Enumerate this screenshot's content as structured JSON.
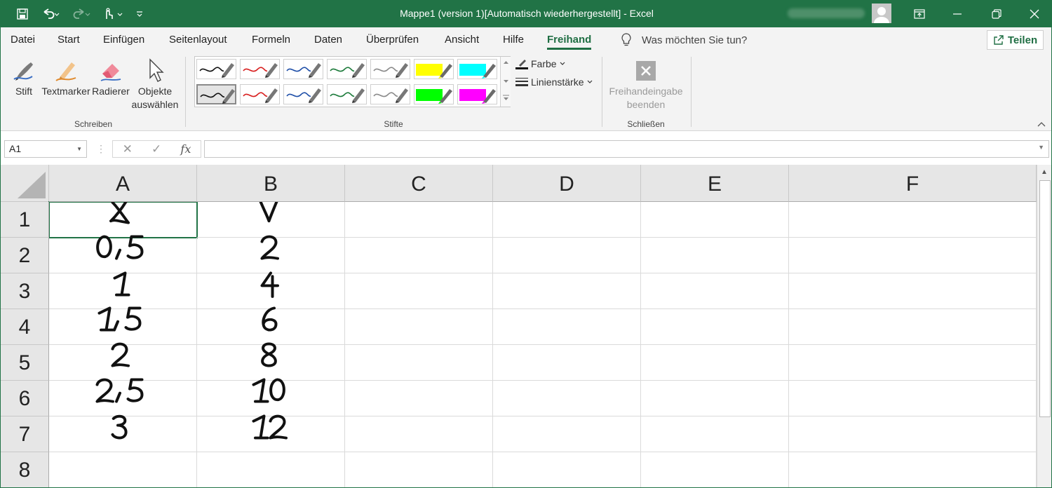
{
  "titlebar": {
    "title": "Mappe1 (version 1)[Automatisch wiederhergestellt]  -  Excel"
  },
  "tabs": [
    "Datei",
    "Start",
    "Einfügen",
    "Seitenlayout",
    "Formeln",
    "Daten",
    "Überprüfen",
    "Ansicht",
    "Hilfe",
    "Freihand"
  ],
  "active_tab": "Freihand",
  "tell_me": "Was möchten Sie tun?",
  "share": "Teilen",
  "ribbon": {
    "schreiben": {
      "label": "Schreiben",
      "stift": "Stift",
      "textmarker": "Textmarker",
      "radierer": "Radierer",
      "objekte_line1": "Objekte",
      "objekte_line2": "auswählen"
    },
    "stifte": {
      "label": "Stifte",
      "pen_colors_row1": [
        "#111111",
        "#d81e1e",
        "#1f4fa8",
        "#1b7a3a",
        "#8a8a8a",
        "#ffff00",
        "#00ffff"
      ],
      "pen_colors_row2": [
        "#111111",
        "#d81e1e",
        "#1f4fa8",
        "#1b7a3a",
        "#8a8a8a",
        "#00ff00",
        "#ff00ff"
      ],
      "farbe": "Farbe",
      "linienstaerke": "Linienstärke"
    },
    "schliessen": {
      "label": "Schließen",
      "line1": "Freihandeingabe",
      "line2": "beenden"
    }
  },
  "formula_bar": {
    "name_box": "A1",
    "formula": ""
  },
  "grid": {
    "columns": [
      "A",
      "B",
      "C",
      "D",
      "E",
      "F"
    ],
    "rows": [
      "1",
      "2",
      "3",
      "4",
      "5",
      "6",
      "7",
      "8"
    ],
    "handwritten": {
      "A": [
        "X",
        "0,5",
        "1",
        "1,5",
        "2",
        "2,5",
        "3"
      ],
      "B": [
        "Y",
        "2",
        "4",
        "6",
        "8",
        "10",
        "12"
      ]
    }
  },
  "colors": {
    "brand": "#217346",
    "accent_text": "#1f6e43"
  }
}
